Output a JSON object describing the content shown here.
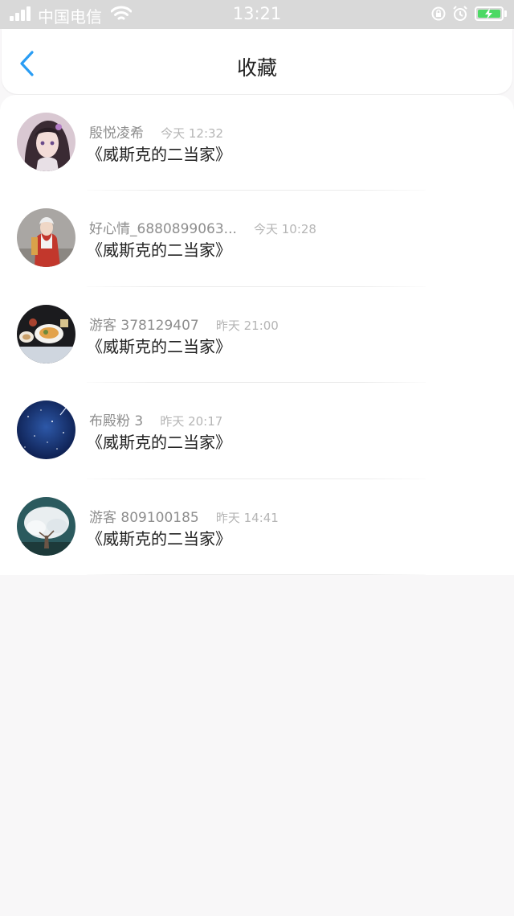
{
  "status_bar": {
    "carrier": "中国电信",
    "time": "13:21",
    "battery_color": "#4cd964"
  },
  "header": {
    "title": "收藏",
    "back_icon": "chevron-left-icon",
    "accent_color": "#2a9df4"
  },
  "favorites": [
    {
      "user": "殷悦凌希",
      "time": "今天 12:32",
      "title": "《威斯克的二当家》"
    },
    {
      "user": "好心情_6880899063...",
      "time": "今天 10:28",
      "title": "《威斯克的二当家》"
    },
    {
      "user": "游客 378129407",
      "time": "昨天 21:00",
      "title": "《威斯克的二当家》"
    },
    {
      "user": "布殿粉 3",
      "time": "昨天 20:17",
      "title": "《威斯克的二当家》"
    },
    {
      "user": "游客 809100185",
      "time": "昨天 14:41",
      "title": "《威斯克的二当家》"
    }
  ]
}
